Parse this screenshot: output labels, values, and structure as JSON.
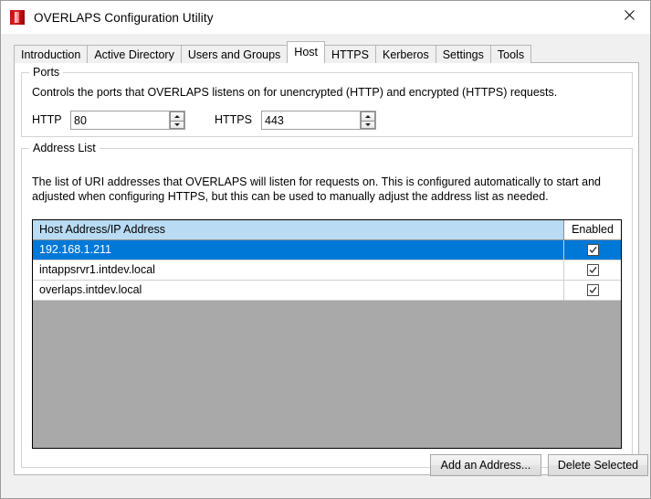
{
  "window": {
    "title": "OVERLAPS Configuration Utility",
    "icon": "app-icon",
    "close_label": "✕"
  },
  "tabs": [
    {
      "id": "introduction",
      "label": "Introduction",
      "selected": false
    },
    {
      "id": "active-directory",
      "label": "Active Directory",
      "selected": false
    },
    {
      "id": "users-and-groups",
      "label": "Users and Groups",
      "selected": false
    },
    {
      "id": "host",
      "label": "Host",
      "selected": true
    },
    {
      "id": "https",
      "label": "HTTPS",
      "selected": false
    },
    {
      "id": "kerberos",
      "label": "Kerberos",
      "selected": false
    },
    {
      "id": "settings",
      "label": "Settings",
      "selected": false
    },
    {
      "id": "tools",
      "label": "Tools",
      "selected": false
    }
  ],
  "ports": {
    "group_title": "Ports",
    "description": "Controls the ports that OVERLAPS listens on for unencrypted (HTTP) and encrypted (HTTPS) requests.",
    "http": {
      "label": "HTTP",
      "value": "80",
      "spinner_up": "▲",
      "spinner_down": "▼"
    },
    "https": {
      "label": "HTTPS",
      "value": "443",
      "spinner_up": "▲",
      "spinner_down": "▼"
    }
  },
  "address_list": {
    "group_title": "Address List",
    "description": "The list of URI addresses that OVERLAPS will listen for requests on. This is configured automatically to start and adjusted when configuring HTTPS, but this can be used to manually adjust the address list as needed.",
    "columns": [
      {
        "id": "host-address",
        "label": "Host Address/IP Address"
      },
      {
        "id": "enabled",
        "label": "Enabled"
      }
    ],
    "rows": [
      {
        "address": "192.168.1.211",
        "enabled": true,
        "selected": true
      },
      {
        "address": "intappsrvr1.intdev.local",
        "enabled": true,
        "selected": false
      },
      {
        "address": "overlaps.intdev.local",
        "enabled": true,
        "selected": false
      }
    ],
    "buttons": {
      "add": "Add an Address...",
      "delete": "Delete Selected"
    }
  },
  "colors": {
    "selection_blue": "#0078d7",
    "header_blue": "#b9dbf3",
    "grid_empty_gray": "#a9a9a9",
    "window_chrome": "#f0f0f0",
    "accent_red": "#d41313"
  }
}
